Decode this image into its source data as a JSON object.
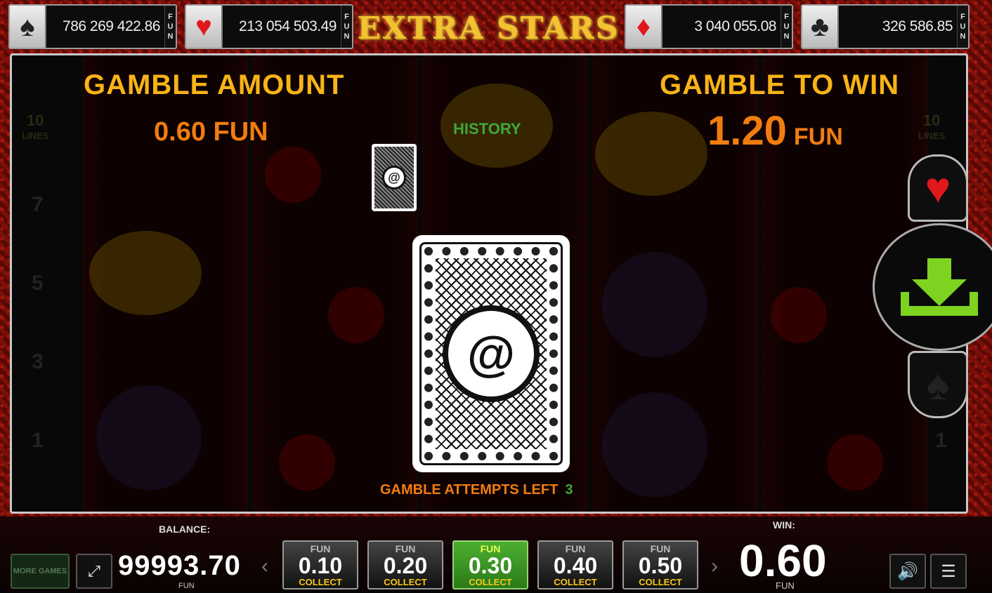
{
  "jackpots": [
    {
      "suit": "spade-icon",
      "glyph": "♠",
      "value": "786 269 422.86",
      "unit": [
        "F",
        "U",
        "N"
      ]
    },
    {
      "suit": "heart-icon",
      "glyph": "♥",
      "value": "213 054 503.49",
      "unit": [
        "F",
        "U",
        "N"
      ]
    },
    {
      "suit": "diamond-icon",
      "glyph": "♦",
      "value": "3 040 055.08",
      "unit": [
        "F",
        "U",
        "N"
      ]
    },
    {
      "suit": "club-icon",
      "glyph": "♣",
      "value": "326 586.85",
      "unit": [
        "F",
        "U",
        "N"
      ]
    }
  ],
  "logo": {
    "text": "EXTRA STARS"
  },
  "gamble": {
    "amount_title": "GAMBLE AMOUNT",
    "amount_value": "0.60 FUN",
    "win_title": "GAMBLE TO WIN",
    "win_value": "1.20",
    "win_unit": "FUN",
    "history_label": "HISTORY",
    "attempts_label": "GAMBLE ATTEMPTS LEFT",
    "attempts_count": "3"
  },
  "line_numbers": [
    "7",
    "5",
    "3",
    "1"
  ],
  "right_line_number": "1",
  "lines_badge": {
    "num": "10",
    "text": "LINES"
  },
  "suit_buttons": {
    "red": "♥",
    "black": "♠"
  },
  "bottom": {
    "more_games": "MORE GAMES",
    "balance_label": "BALANCE:",
    "balance_value": "99993.70",
    "balance_unit": "FUN",
    "win_label": "WIN:",
    "win_value": "0.60",
    "win_unit": "FUN",
    "bets": [
      {
        "unit": "FUN",
        "value": "0.10",
        "action": "COLLECT"
      },
      {
        "unit": "FUN",
        "value": "0.20",
        "action": "COLLECT"
      },
      {
        "unit": "FUN",
        "value": "0.30",
        "action": "COLLECT"
      },
      {
        "unit": "FUN",
        "value": "0.40",
        "action": "COLLECT"
      },
      {
        "unit": "FUN",
        "value": "0.50",
        "action": "COLLECT"
      }
    ]
  }
}
